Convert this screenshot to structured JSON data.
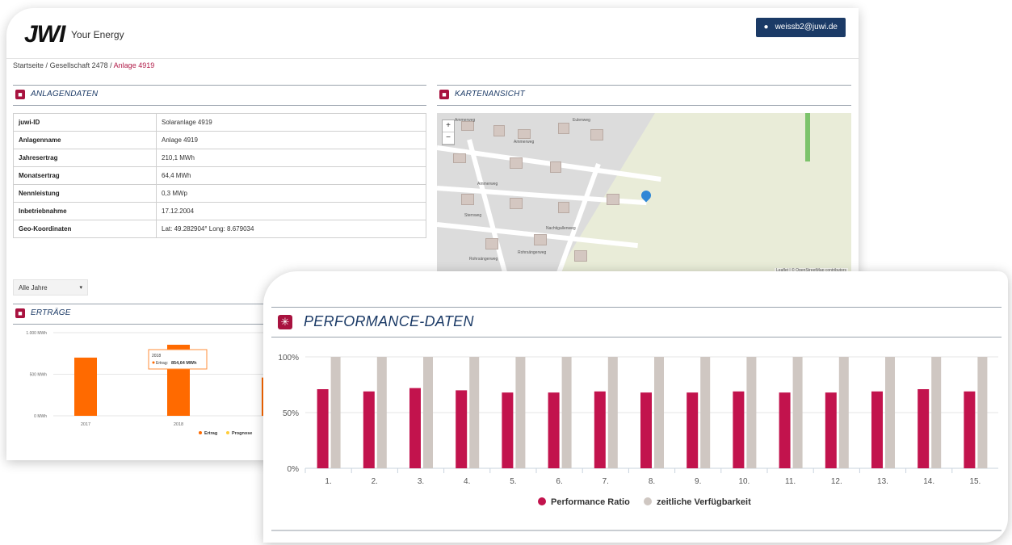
{
  "header": {
    "logo": "JWI",
    "tagline": "Your Energy",
    "user": "weissb2@juwi.de"
  },
  "breadcrumb": {
    "items": [
      "Startseite",
      "Gesellschaft 2478"
    ],
    "active": "Anlage 4919",
    "separator": "/"
  },
  "anlagendaten": {
    "title": "ANLAGENDATEN",
    "rows": [
      {
        "key": "juwi-ID",
        "value": "Solaranlage 4919"
      },
      {
        "key": "Anlagenname",
        "value": "Anlage 4919"
      },
      {
        "key": "Jahresertrag",
        "value": "210,1 MWh"
      },
      {
        "key": "Monatsertrag",
        "value": "64,4 MWh"
      },
      {
        "key": "Nennleistung",
        "value": "0,3 MWp"
      },
      {
        "key": "Inbetriebnahme",
        "value": "17.12.2004"
      },
      {
        "key": "Geo-Koordinaten",
        "value": "Lat: 49.282904° Long: 8.679034"
      }
    ]
  },
  "kartenansicht": {
    "title": "KARTENANSICHT",
    "zoom_in": "+",
    "zoom_out": "−",
    "attribution": "Leaflet | © OpenStreetMap contributors",
    "street_labels": [
      "Ammerweg",
      "Eulenweg",
      "Ammerweg",
      "Ammerweg",
      "Sternweg",
      "Rohrsängerweg",
      "Nachtigallenweg",
      "Rohrsängerweg"
    ]
  },
  "filter": {
    "selected": "Alle Jahre",
    "caret": "▾"
  },
  "ertraege": {
    "title": "ERTRÄGE",
    "tooltip": {
      "year": "2018",
      "label": "Ertrag:",
      "value": "854,64 MWh"
    },
    "legend": [
      "Ertrag",
      "Prognose"
    ],
    "colors": {
      "ertrag": "#ff6a00",
      "prognose": "#ffcd38"
    }
  },
  "chart_data": [
    {
      "type": "bar",
      "categories": [
        "2017",
        "2018"
      ],
      "series": [
        {
          "name": "Ertrag",
          "values": [
            700,
            854.64
          ]
        }
      ],
      "title": "",
      "xlabel": "",
      "ylabel": "",
      "ylim": [
        0,
        1000
      ],
      "yticks": [
        "0 MWh",
        "500 MWh",
        "1.000 MWh"
      ],
      "partial_third_bar": 460
    },
    {
      "type": "bar",
      "title": "PERFORMANCE-DATEN",
      "categories": [
        "1.",
        "2.",
        "3.",
        "4.",
        "5.",
        "6.",
        "7.",
        "8.",
        "9.",
        "10.",
        "11.",
        "12.",
        "13.",
        "14.",
        "15."
      ],
      "series": [
        {
          "name": "Performance Ratio",
          "color": "#c2134d",
          "values": [
            71,
            69,
            72,
            70,
            68,
            68,
            69,
            68,
            68,
            69,
            68,
            68,
            69,
            71,
            69
          ]
        },
        {
          "name": "zeitliche Verfügbarkeit",
          "color": "#cfc7c2",
          "values": [
            100,
            100,
            100,
            100,
            100,
            100,
            100,
            100,
            100,
            100,
            100,
            100,
            100,
            100,
            100
          ]
        }
      ],
      "yticks": [
        "0%",
        "50%",
        "100%"
      ],
      "ylim": [
        0,
        100
      ],
      "grid": true,
      "legend_position": "bottom"
    }
  ]
}
